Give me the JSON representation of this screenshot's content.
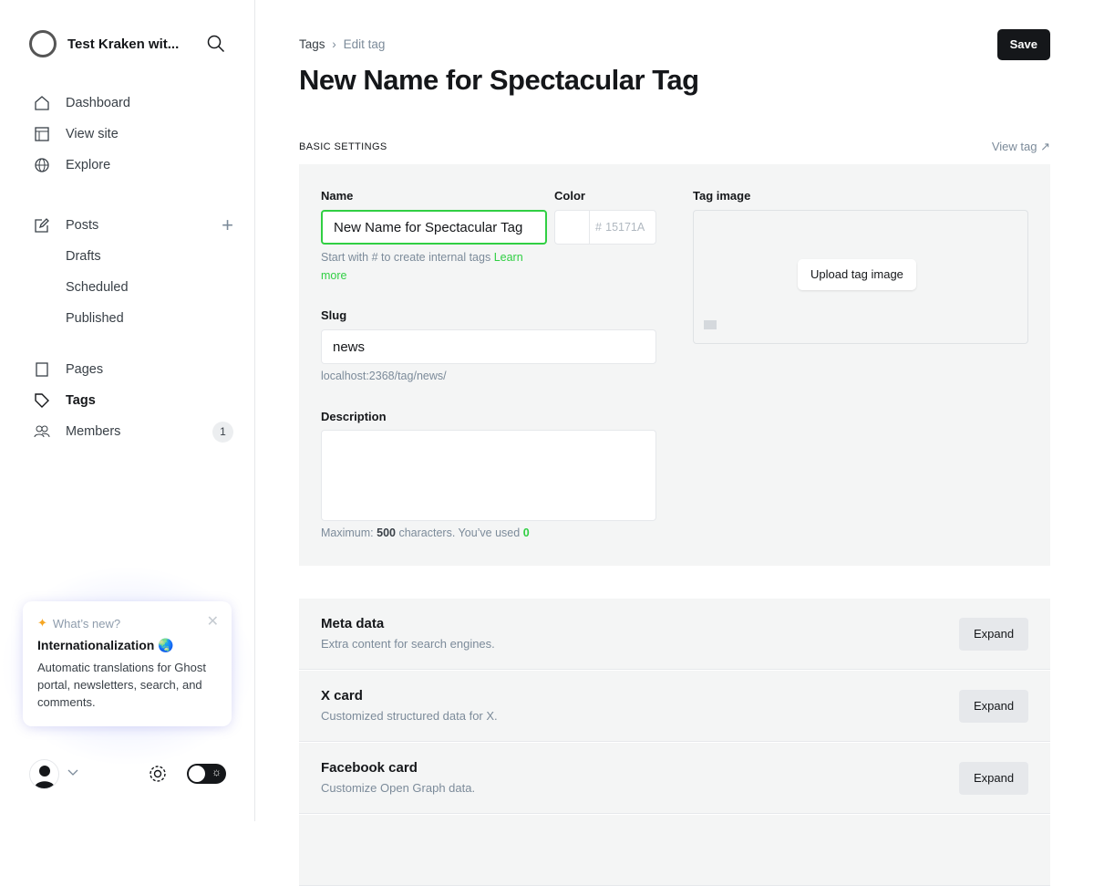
{
  "sidebar": {
    "site_name": "Test Kraken wit...",
    "nav": [
      {
        "label": "Dashboard"
      },
      {
        "label": "View site"
      },
      {
        "label": "Explore"
      }
    ],
    "posts": {
      "label": "Posts",
      "subs": [
        "Drafts",
        "Scheduled",
        "Published"
      ]
    },
    "nav2": [
      {
        "label": "Pages"
      },
      {
        "label": "Tags"
      },
      {
        "label": "Members",
        "badge": "1"
      }
    ],
    "whats_new": {
      "heading": "What’s new?",
      "title": "Internationalization 🌏",
      "body": "Automatic translations for Ghost portal, newsletters, search, and comments."
    }
  },
  "header": {
    "crumb_root": "Tags",
    "crumb_current": "Edit tag",
    "title": "New Name for Spectacular Tag",
    "save": "Save"
  },
  "basic": {
    "section": "BASIC SETTINGS",
    "view_tag": "View tag",
    "name_label": "Name",
    "name_value": "New Name for Spectacular Tag",
    "name_hint": "Start with # to create internal tags",
    "learn_more": "Learn more",
    "color_label": "Color",
    "color_placeholder": "15171A",
    "slug_label": "Slug",
    "slug_value": "news",
    "slug_url": "localhost:2368/tag/news/",
    "desc_label": "Description",
    "desc_hint_pre": "Maximum:",
    "desc_max": "500",
    "desc_hint_mid": "characters. You’ve used",
    "desc_used": "0",
    "image_label": "Tag image",
    "upload": "Upload tag image"
  },
  "sections": [
    {
      "title": "Meta data",
      "sub": "Extra content for search engines.",
      "button": "Expand"
    },
    {
      "title": "X card",
      "sub": "Customized structured data for X.",
      "button": "Expand"
    },
    {
      "title": "Facebook card",
      "sub": "Customize Open Graph data.",
      "button": "Expand"
    }
  ]
}
